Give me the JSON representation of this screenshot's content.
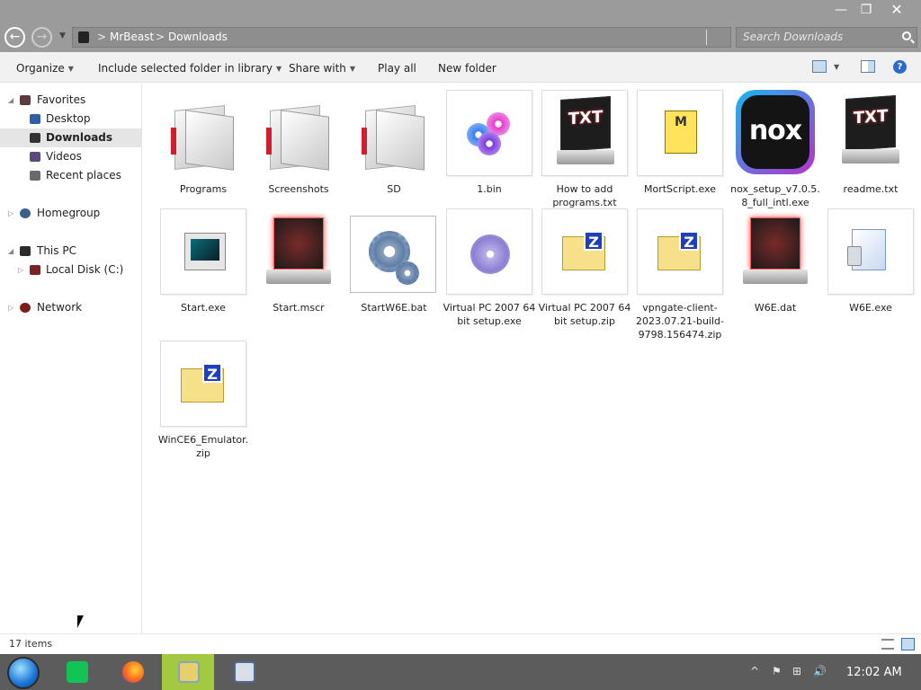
{
  "window": {
    "minimize_glyph": "—",
    "maximize_glyph": "❐",
    "close_glyph": "✕"
  },
  "nav": {
    "back_glyph": "←",
    "forward_glyph": "→",
    "recent_glyph": "▼",
    "breadcrumb": [
      "MrBeast",
      "Downloads"
    ],
    "breadcrumb_sep": ">",
    "search_placeholder": "Search Downloads"
  },
  "toolbar": {
    "organize": "Organize",
    "include_library": "Include selected folder in library",
    "share_with": "Share with",
    "play_all": "Play all",
    "new_folder": "New folder",
    "help_glyph": "?"
  },
  "sidebar": {
    "favorites": "Favorites",
    "favorites_items": [
      "Desktop",
      "Downloads",
      "Videos",
      "Recent places"
    ],
    "selected": "Downloads",
    "homegroup": "Homegroup",
    "this_pc": "This PC",
    "this_pc_items": [
      "Local Disk (C:)"
    ],
    "network": "Network"
  },
  "files": [
    {
      "name": "Programs",
      "icon": "folder-icon"
    },
    {
      "name": "Screenshots",
      "icon": "folder-icon"
    },
    {
      "name": "SD",
      "icon": "folder-icon"
    },
    {
      "name": "1.bin",
      "icon": "discs-icon"
    },
    {
      "name": "How to add programs.txt",
      "icon": "txt-monitor-icon"
    },
    {
      "name": "MortScript.exe",
      "icon": "scroll-icon"
    },
    {
      "name": "nox_setup_v7.0.5.8_full_intl.exe",
      "icon": "nox-icon"
    },
    {
      "name": "readme.txt",
      "icon": "txt-monitor-icon"
    },
    {
      "name": "Start.exe",
      "icon": "emulator-window-icon"
    },
    {
      "name": "Start.mscr",
      "icon": "alien-monitor-icon"
    },
    {
      "name": "StartW6E.bat",
      "icon": "gears-icon"
    },
    {
      "name": "Virtual PC 2007 64 bit setup.exe",
      "icon": "disc-icon"
    },
    {
      "name": "Virtual PC 2007 64 bit setup.zip",
      "icon": "zip-icon"
    },
    {
      "name": "vpngate-client-2023.07.21-build-9798.156474.zip",
      "icon": "zip-icon"
    },
    {
      "name": "W6E.dat",
      "icon": "alien-monitor-icon"
    },
    {
      "name": "W6E.exe",
      "icon": "device-exe-icon"
    },
    {
      "name": "WinCE6_Emulator.zip",
      "icon": "zip-icon"
    }
  ],
  "status": {
    "item_count": "17 items"
  },
  "taskbar": {
    "apps": [
      "start-orb-icon",
      "sheets-app-icon",
      "firefox-icon",
      "file-explorer-icon",
      "device-manager-icon"
    ],
    "tray_glyphs": [
      "^",
      "⚑",
      "⊞",
      "🔊"
    ],
    "clock": "12:02 AM"
  },
  "colors": {
    "titlebar": "#9b9b9b",
    "taskbar": "#5c5c5c",
    "taskbar_active": "#a3c93f",
    "sidebar_selected": "#e5e5e5"
  }
}
